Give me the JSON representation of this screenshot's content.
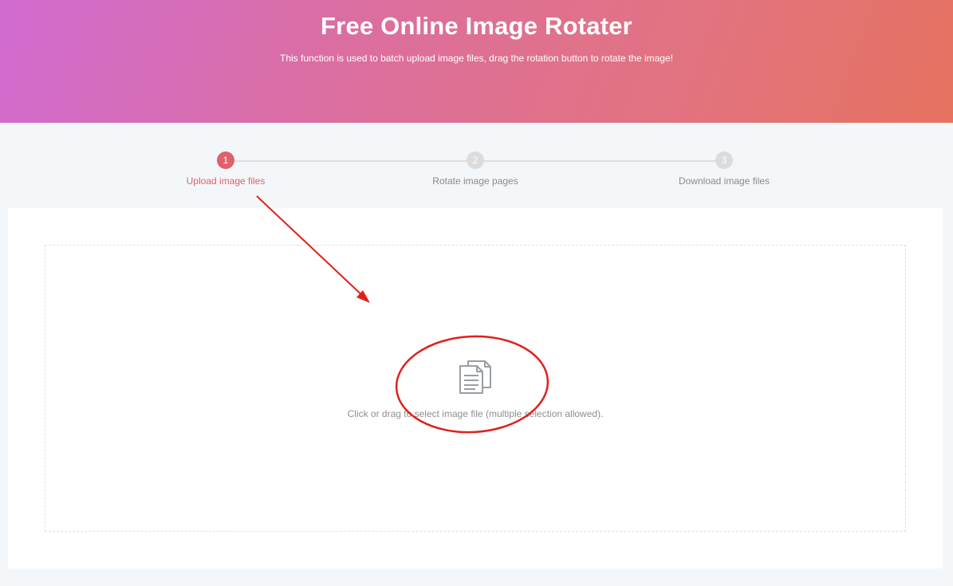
{
  "header": {
    "title": "Free Online Image Rotater",
    "subtitle": "This function is used to batch upload image files, drag the rotation button to rotate the image!"
  },
  "steps": [
    {
      "number": "1",
      "label": "Upload image files",
      "active": true
    },
    {
      "number": "2",
      "label": "Rotate image pages",
      "active": false
    },
    {
      "number": "3",
      "label": "Download image files",
      "active": false
    }
  ],
  "upload": {
    "icon": "file-copy-icon",
    "instruction": "Click or drag to select image file (multiple selection allowed)."
  },
  "colors": {
    "accent": "#e0606b",
    "annotation": "#e0201a",
    "inactive_step": "#dcdcdc"
  }
}
